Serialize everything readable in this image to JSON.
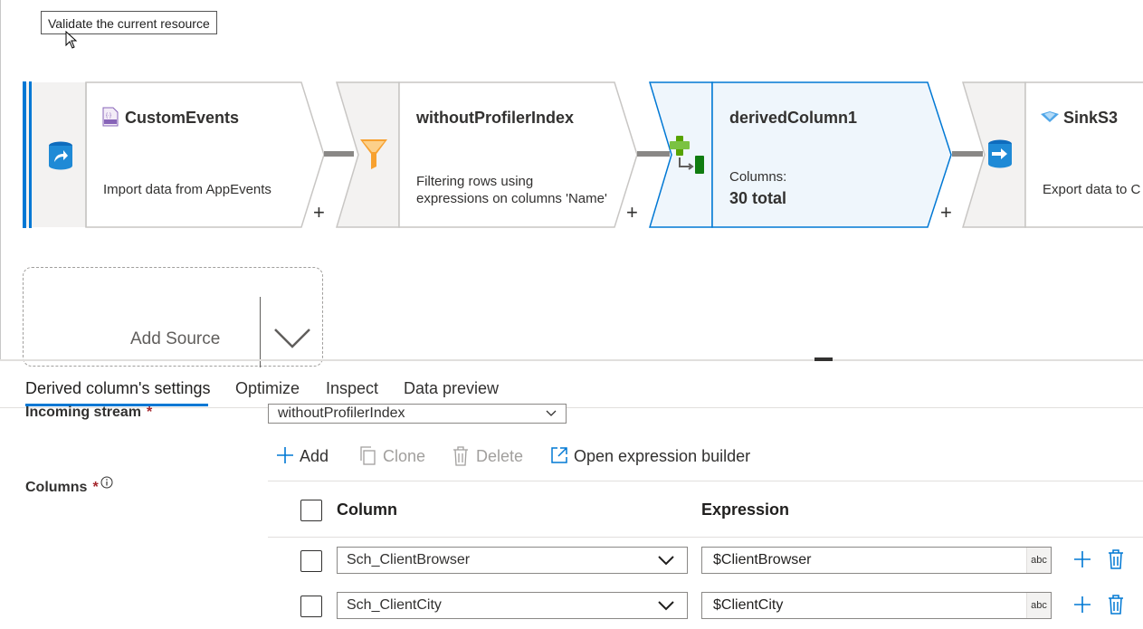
{
  "tooltip": {
    "text": "Validate the current resource"
  },
  "nodes": [
    {
      "title": "CustomEvents",
      "description_lines": [
        "Import data from AppEvents"
      ],
      "icon": "source-database-icon",
      "title_icon": "json-file-icon"
    },
    {
      "title": "withoutProfilerIndex",
      "description_lines": [
        "Filtering rows using",
        "expressions on columns 'Name'"
      ],
      "icon": "filter-funnel-icon"
    },
    {
      "title": "derivedColumn1",
      "columns_label": "Columns:",
      "columns_value": "30 total",
      "icon": "derived-column-icon",
      "selected": true
    },
    {
      "title": "SinkS3",
      "description_lines": [
        "Export data to C"
      ],
      "icon": "sink-database-icon",
      "title_icon": "s3-icon"
    }
  ],
  "plus_symbol": "+",
  "add_source": {
    "label": "Add Source"
  },
  "tabs": [
    {
      "label": "Derived column's settings",
      "active": true
    },
    {
      "label": "Optimize"
    },
    {
      "label": "Inspect"
    },
    {
      "label": "Data preview"
    }
  ],
  "settings": {
    "incoming_stream_label": "Incoming stream",
    "incoming_stream_value": "withoutProfilerIndex",
    "columns_label": "Columns",
    "required_mark": "*",
    "info_icon": "info-icon"
  },
  "toolbar": {
    "add": "Add",
    "clone": "Clone",
    "delete": "Delete",
    "open_expression_builder": "Open expression builder"
  },
  "grid": {
    "headers": {
      "column": "Column",
      "expression": "Expression"
    },
    "rows": [
      {
        "column": "Sch_ClientBrowser",
        "expression": "$ClientBrowser",
        "type": "abc"
      },
      {
        "column": "Sch_ClientCity",
        "expression": "$ClientCity",
        "type": "abc"
      }
    ]
  },
  "colors": {
    "accent": "#0078d4",
    "selected_node_bg": "#eff6fc",
    "funnel": "#f7a130",
    "derived_green": "#57a300"
  }
}
